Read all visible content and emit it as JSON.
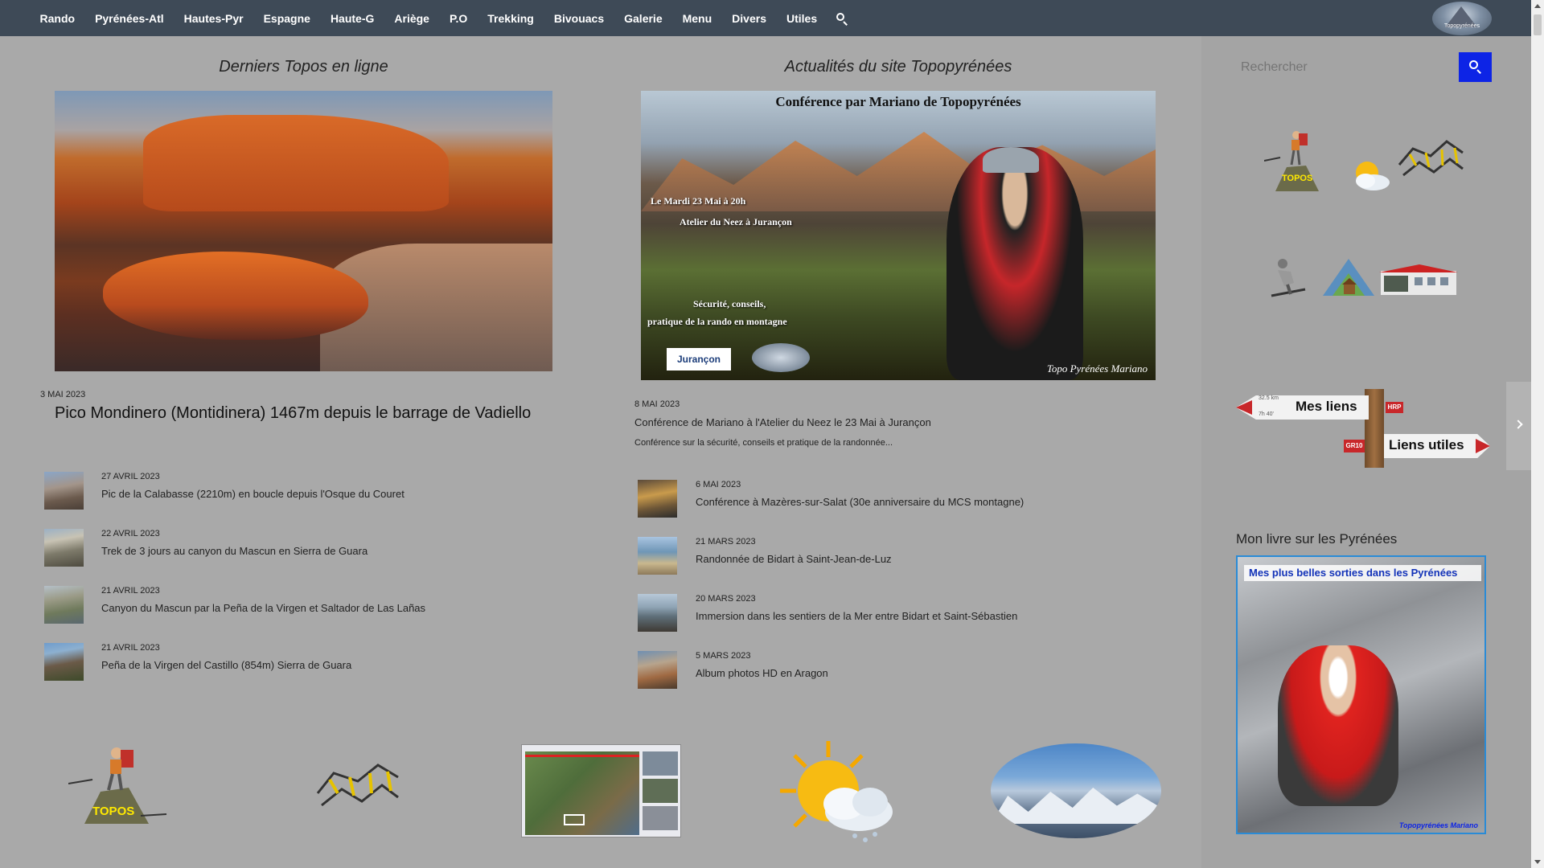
{
  "nav": {
    "items": [
      "Rando",
      "Pyrénées-Atl",
      "Hautes-Pyr",
      "Espagne",
      "Haute-G",
      "Ariège",
      "P.O",
      "Trekking",
      "Bivouacs",
      "Galerie",
      "Menu",
      "Divers",
      "Utiles"
    ],
    "logo_text": "Topopyrénées"
  },
  "left": {
    "section_title": "Derniers Topos en ligne",
    "featured": {
      "date": "3 MAI 2023",
      "title": "Pico Mondinero (Montidinera) 1467m depuis le barrage de Vadiello"
    },
    "posts": [
      {
        "date": "27 AVRIL 2023",
        "title": "Pic de la Calabasse (2210m) en boucle depuis l'Osque du Couret"
      },
      {
        "date": "22 AVRIL 2023",
        "title": "Trek de 3 jours au canyon du Mascun en Sierra de Guara"
      },
      {
        "date": "21 AVRIL 2023",
        "title": "Canyon du Mascun par la Peña de la Virgen et Saltador de Las Lañas"
      },
      {
        "date": "21 AVRIL 2023",
        "title": "Peña de la Virgen del Castillo (854m) Sierra de Guara"
      }
    ]
  },
  "right": {
    "section_title": "Actualités du site Topopyrénées",
    "featured": {
      "image_heading": "Conférence par Mariano de Topopyrénées",
      "image_line1": "Le Mardi 23 Mai à 20h",
      "image_line2": "Atelier du Neez à Jurançon",
      "image_line3": "Sécurité, conseils,",
      "image_line4": "pratique de la rando en montagne",
      "image_badge": "Jurançon",
      "image_signature": "Topo Pyrénées Mariano",
      "date": "8 MAI 2023",
      "title": "Conférence de Mariano à l'Atelier du Neez le 23 Mai à Jurançon",
      "excerpt": "Conférence sur la sécurité, conseils et pratique de la randonnée..."
    },
    "posts": [
      {
        "date": "6 MAI 2023",
        "title": "Conférence à Mazères-sur-Salat (30e anniversaire du MCS montagne)"
      },
      {
        "date": "21 MARS 2023",
        "title": "Randonnée de Bidart à Saint-Jean-de-Luz"
      },
      {
        "date": "20 MARS 2023",
        "title": "Immersion dans les sentiers de la Mer entre Bidart et Saint-Sébastien"
      },
      {
        "date": "5 MARS 2023",
        "title": "Album photos HD en Aragon"
      }
    ]
  },
  "bottom_icons": {
    "topos_label": "TOPOS"
  },
  "sidebar": {
    "search_placeholder": "Rechercher",
    "icons": {
      "topos_label": "TOPOS"
    },
    "signs": {
      "links_label": "Mes liens",
      "useful_label": "Liens utiles",
      "hrp": "HRP",
      "gr": "GR10",
      "distance": "32.5 km",
      "time": "7h 40'"
    },
    "book_widget_title": "Mon livre sur les Pyrénées",
    "book_banner": "Mes plus belles sorties dans les Pyrénées",
    "book_credit": "Topopyrénées Mariano"
  },
  "colors": {
    "nav_bg": "#3e4a57",
    "page_bg": "#a9a9a9",
    "search_button": "#0d24e6"
  }
}
